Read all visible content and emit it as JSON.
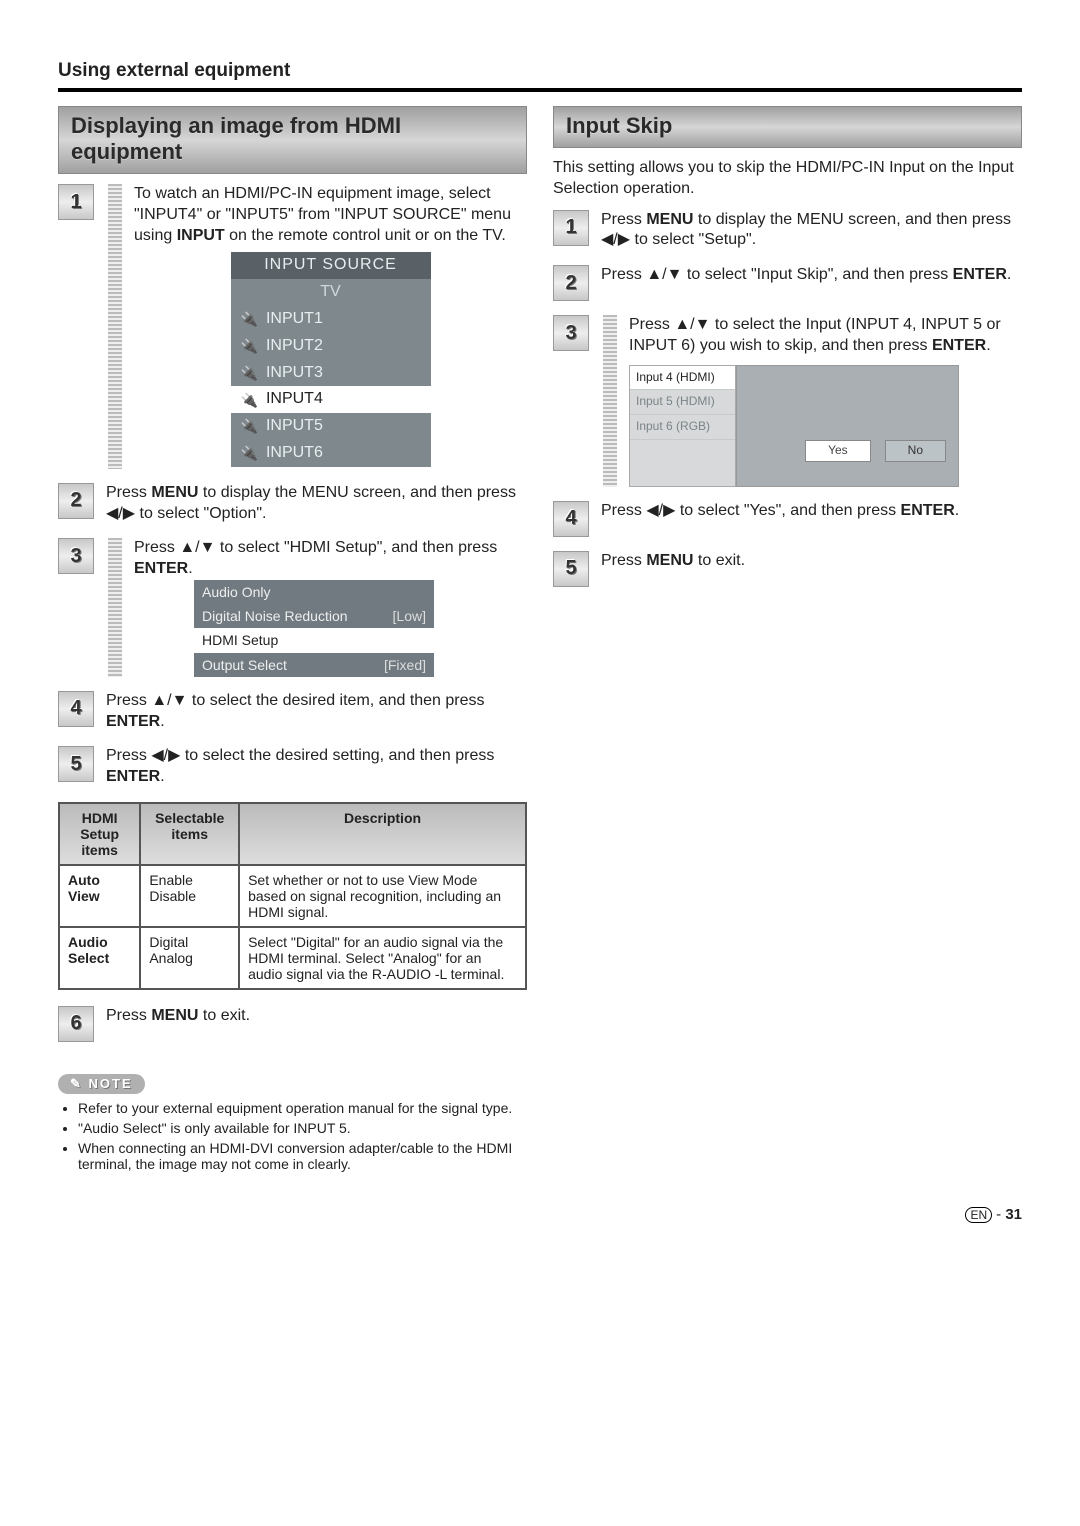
{
  "page_header": "Using external equipment",
  "left": {
    "title": "Displaying an image from HDMI equipment",
    "steps": {
      "1": {
        "pre": "To watch an HDMI/PC-IN equipment image, select \"INPUT4\" or \"INPUT5\" from \"INPUT SOURCE\" menu using ",
        "b1": "INPUT",
        "post": " on the remote control unit or on the TV."
      },
      "2": {
        "pre": "Press ",
        "b1": "MENU",
        "mid": " to display the MENU screen, and then press ",
        "arr": "◀/▶",
        "post": " to select \"Option\"."
      },
      "3": {
        "pre": "Press ",
        "arr": "▲/▼",
        "mid": " to select \"HDMI Setup\", and then press ",
        "b1": "ENTER",
        "post": "."
      },
      "4": {
        "pre": "Press ",
        "arr": "▲/▼",
        "mid": " to select the desired item, and then press ",
        "b1": "ENTER",
        "post": "."
      },
      "5": {
        "pre": "Press ",
        "arr": "◀/▶",
        "mid": " to select the desired setting, and then press ",
        "b1": "ENTER",
        "post": "."
      },
      "6": {
        "pre": "Press ",
        "b1": "MENU",
        "post": " to exit."
      }
    },
    "input_source": {
      "header": "INPUT SOURCE",
      "items": [
        "TV",
        "INPUT1",
        "INPUT2",
        "INPUT3",
        "INPUT4",
        "INPUT5",
        "INPUT6"
      ],
      "selected_index": 4
    },
    "menu_items": [
      {
        "label": "Audio Only",
        "value": ""
      },
      {
        "label": "Digital Noise Reduction",
        "value": "[Low]"
      },
      {
        "label": "HDMI Setup",
        "value": ""
      },
      {
        "label": "Output Select",
        "value": "[Fixed]"
      }
    ],
    "menu_selected_index": 2,
    "table": {
      "headers": [
        "HDMI Setup items",
        "Selectable items",
        "Description"
      ],
      "rows": [
        {
          "c0": "Auto View",
          "c1": "Enable\nDisable",
          "c2": "Set whether or not to use View Mode based on signal recognition, including an HDMI signal."
        },
        {
          "c0": "Audio Select",
          "c1": "Digital\nAnalog",
          "c2": "Select \"Digital\" for an audio signal via the HDMI terminal. Select \"Analog\" for an audio signal via the R-AUDIO -L terminal."
        }
      ]
    },
    "note_label": "NOTE",
    "notes": [
      "Refer to your external equipment operation manual for the signal type.",
      "\"Audio Select\" is only available for INPUT 5.",
      "When connecting an HDMI-DVI conversion adapter/cable to the HDMI terminal, the image may not come in clearly."
    ]
  },
  "right": {
    "title": "Input Skip",
    "intro": "This setting allows you to skip the HDMI/PC-IN Input on the Input Selection operation.",
    "steps": {
      "1": {
        "pre": "Press ",
        "b1": "MENU",
        "mid": " to display the MENU screen, and then press ",
        "arr": "◀/▶",
        "post": " to select \"Setup\"."
      },
      "2": {
        "pre": "Press ",
        "arr": "▲/▼",
        "mid": " to select \"Input Skip\", and then press ",
        "b1": "ENTER",
        "post": "."
      },
      "3": {
        "pre": "Press ",
        "arr": "▲/▼",
        "mid": " to select the Input (INPUT 4, INPUT 5 or INPUT 6) you wish to skip, and then press ",
        "b1": "ENTER",
        "post": "."
      },
      "4": {
        "pre": "Press ",
        "arr": "◀/▶",
        "mid": " to select \"Yes\", and then press ",
        "b1": "ENTER",
        "post": "."
      },
      "5": {
        "pre": "Press ",
        "b1": "MENU",
        "post": " to exit."
      }
    },
    "skip_list": {
      "items": [
        "Input 4 (HDMI)",
        "Input 5 (HDMI)",
        "Input 6 (RGB)"
      ],
      "selected_index": 0,
      "yes": "Yes",
      "no": "No"
    }
  },
  "footer": {
    "lang": "EN",
    "sep": "-",
    "page": "31"
  }
}
